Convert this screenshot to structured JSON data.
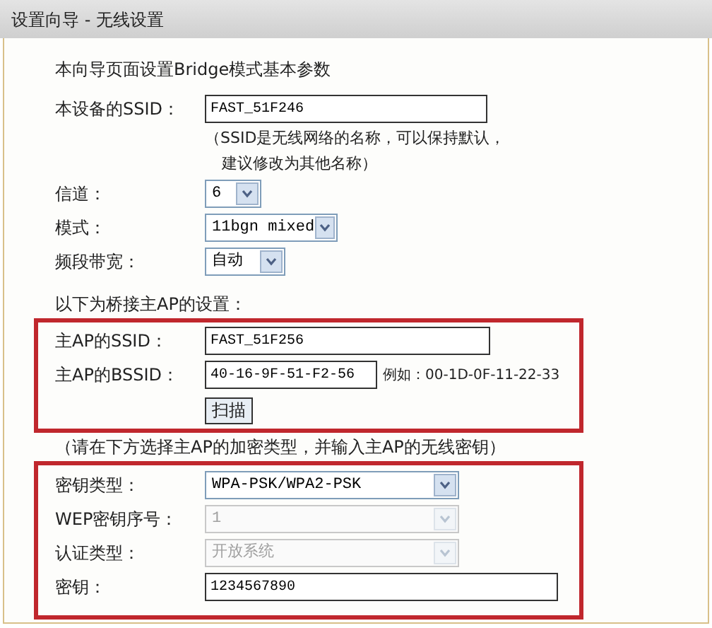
{
  "window": {
    "title": "设置向导 - 无线设置"
  },
  "intro": "本向导页面设置Bridge模式基本参数",
  "device_fields": [
    {
      "kind": "text",
      "label": "本设备的SSID：",
      "value": "FAST_51F246",
      "disabled": false,
      "hint": [
        "（SSID是无线网络的名称，可以保持默认，",
        "建议修改为其他名称）"
      ]
    },
    {
      "kind": "select",
      "label": "信道：",
      "value": "6",
      "disabled": false
    },
    {
      "kind": "select",
      "label": "模式：",
      "value": "11bgn mixed",
      "disabled": false
    },
    {
      "kind": "select",
      "label": "频段带宽：",
      "value": "自动",
      "disabled": false
    }
  ],
  "bridge_heading": "以下为桥接主AP的设置：",
  "ap_fields": [
    {
      "kind": "text",
      "label": "主AP的SSID：",
      "value": "FAST_51F256",
      "disabled": false
    },
    {
      "kind": "text",
      "label": "主AP的BSSID：",
      "value": "40-16-9F-51-F2-56",
      "disabled": false,
      "example": "例如：00-1D-0F-11-22-33"
    }
  ],
  "scan_button": "扫描",
  "security_note": "（请在下方选择主AP的加密类型，并输入主AP的无线密钥）",
  "security_fields": [
    {
      "kind": "select",
      "label": "密钥类型：",
      "value": "WPA-PSK/WPA2-PSK",
      "disabled": false
    },
    {
      "kind": "select",
      "label": "WEP密钥序号：",
      "value": "1",
      "disabled": true
    },
    {
      "kind": "select",
      "label": "认证类型：",
      "value": "开放系统",
      "disabled": true
    },
    {
      "kind": "text",
      "label": "密钥：",
      "value": "1234567890",
      "disabled": false
    }
  ]
}
